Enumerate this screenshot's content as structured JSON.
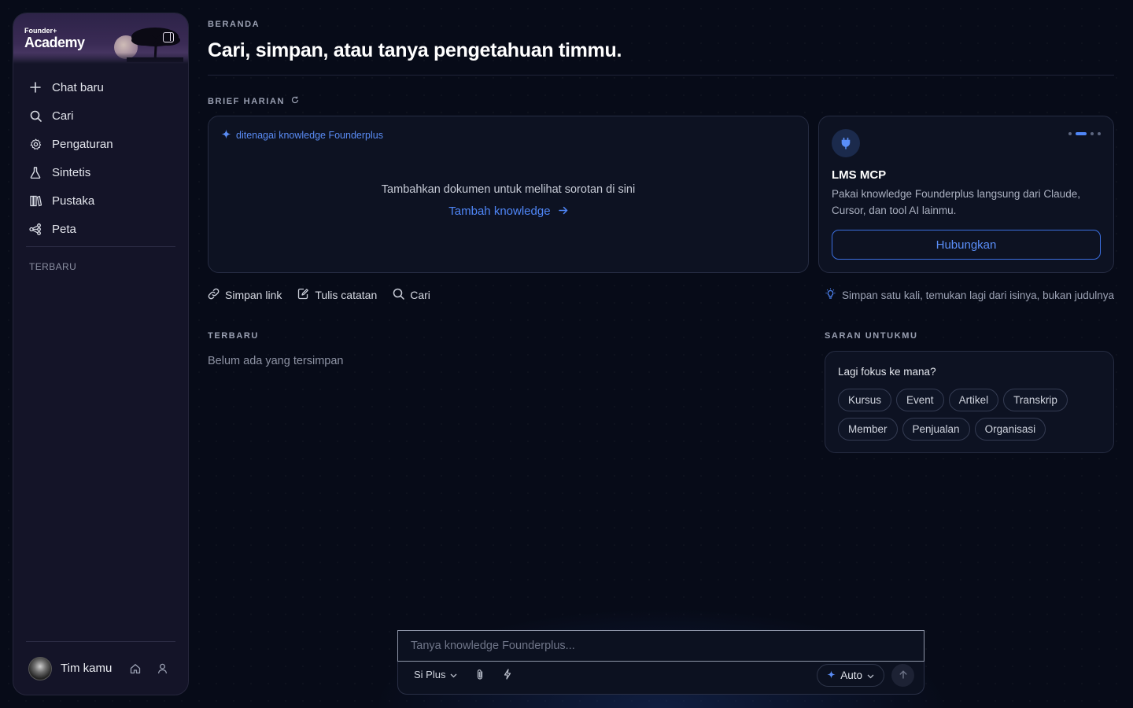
{
  "brand": {
    "small": "Founder+",
    "name": "Academy"
  },
  "sidebar": {
    "items": [
      {
        "label": "Chat baru",
        "icon": "plus-icon"
      },
      {
        "label": "Cari",
        "icon": "search-icon"
      },
      {
        "label": "Pengaturan",
        "icon": "gear-icon"
      },
      {
        "label": "Sintetis",
        "icon": "flask-icon"
      },
      {
        "label": "Pustaka",
        "icon": "library-icon"
      },
      {
        "label": "Peta",
        "icon": "graph-icon"
      }
    ],
    "recent_label": "TERBARU",
    "user_name": "Tim kamu"
  },
  "header": {
    "eyebrow": "BERANDA",
    "title": "Cari, simpan, atau tanya pengetahuan timmu."
  },
  "brief": {
    "label": "BRIEF HARIAN",
    "powered": "ditenagai knowledge Founderplus",
    "empty": "Tambahkan dokumen untuk melihat sorotan di sini",
    "add_link": "Tambah knowledge"
  },
  "mcp": {
    "title": "LMS MCP",
    "desc": "Pakai knowledge Founderplus langsung dari Claude, Cursor, dan tool AI lainmu.",
    "button": "Hubungkan"
  },
  "actions": [
    {
      "label": "Simpan link",
      "icon": "link-icon"
    },
    {
      "label": "Tulis catatan",
      "icon": "note-edit-icon"
    },
    {
      "label": "Cari",
      "icon": "search-icon"
    }
  ],
  "tip": "Simpan satu kali, temukan lagi dari isinya, bukan judulnya",
  "recent": {
    "label": "TERBARU",
    "empty": "Belum ada yang tersimpan"
  },
  "suggestions": {
    "label": "SARAN UNTUKMU",
    "question": "Lagi fokus ke mana?",
    "chips": [
      "Kursus",
      "Event",
      "Artikel",
      "Transkrip",
      "Member",
      "Penjualan",
      "Organisasi"
    ]
  },
  "composer": {
    "placeholder": "Tanya knowledge Founderplus...",
    "model": "Si Plus",
    "mode": "Auto"
  },
  "colors": {
    "accent": "#4f86f7",
    "background": "#070b18",
    "sidebar": "#141428"
  }
}
